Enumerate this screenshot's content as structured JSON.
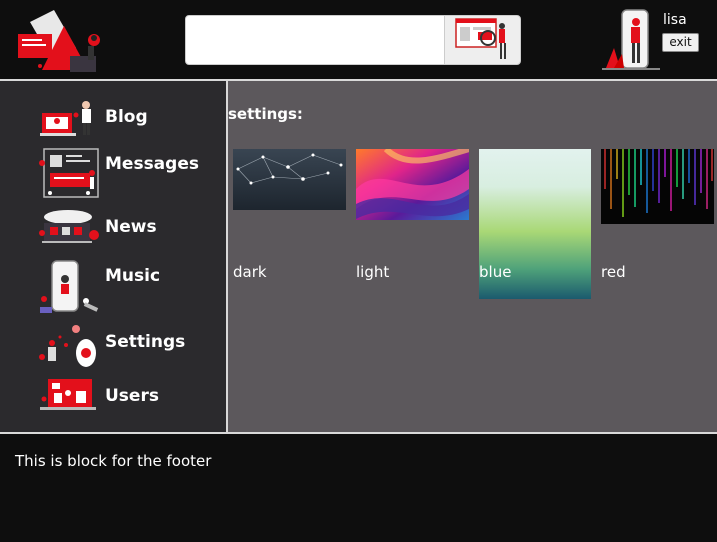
{
  "header": {
    "search": {
      "value": "",
      "placeholder": ""
    },
    "user": {
      "name": "lisa",
      "exit_label": "exit"
    }
  },
  "sidebar": {
    "items": [
      {
        "label": "Blog",
        "icon": "blog-icon"
      },
      {
        "label": "Messages",
        "icon": "messages-icon"
      },
      {
        "label": "News",
        "icon": "news-icon"
      },
      {
        "label": "Music",
        "icon": "music-icon"
      },
      {
        "label": "Settings",
        "icon": "settings-icon"
      },
      {
        "label": "Users",
        "icon": "users-icon"
      }
    ]
  },
  "main": {
    "title": "settings:",
    "themes": [
      {
        "label": "dark"
      },
      {
        "label": "light"
      },
      {
        "label": "blue"
      },
      {
        "label": "red"
      }
    ]
  },
  "footer": {
    "text": "This is block for the footer"
  },
  "colors": {
    "accent": "#e3101b",
    "header_bg": "#0e0e0e",
    "sidebar_bg": "#2b2a2d",
    "main_bg": "#5c585c",
    "divider": "#d9d9d9"
  }
}
